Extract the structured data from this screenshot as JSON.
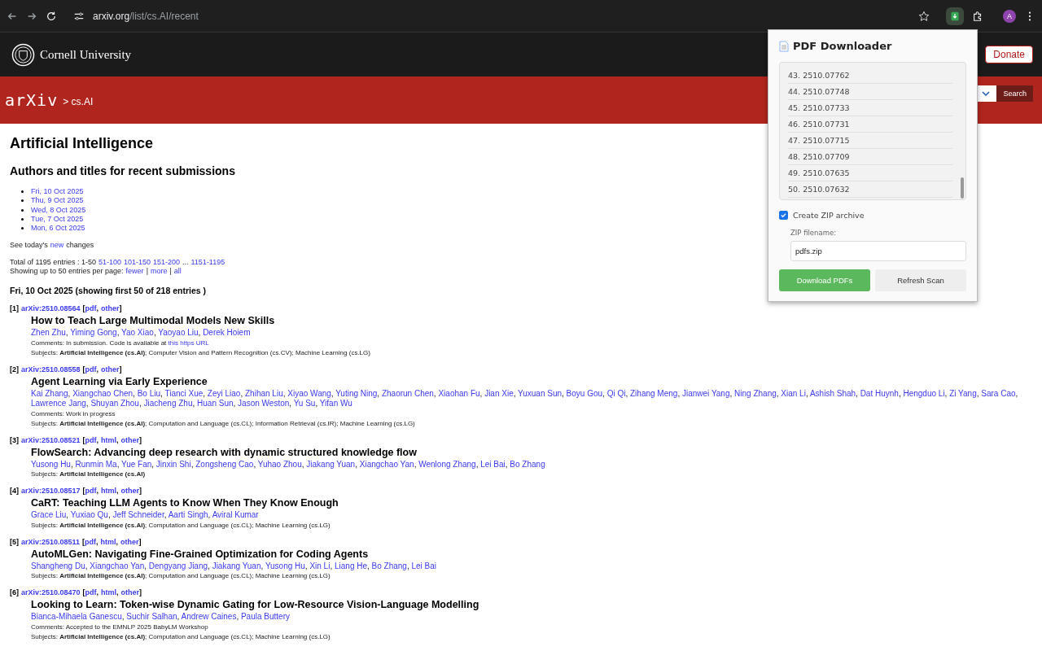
{
  "browser": {
    "url_host": "arxiv.org",
    "url_path": "/list/cs.AI/recent",
    "avatar": "A"
  },
  "header": {
    "institution": "Cornell University",
    "donate": "Donate",
    "logo": "arXiv",
    "breadcrumb": "> cs.AI",
    "search_button": "Search"
  },
  "popup": {
    "title": "PDF Downloader",
    "items": [
      "43. 2510.07762",
      "44. 2510.07748",
      "45. 2510.07733",
      "46. 2510.07731",
      "47. 2510.07715",
      "48. 2510.07709",
      "49. 2510.07635",
      "50. 2510.07632"
    ],
    "zip_archive": {
      "label": "Create ZIP archive",
      "checked": true
    },
    "filename_label": "ZIP filename:",
    "filename_value": "pdfs.zip",
    "buttons": [
      {
        "label": "Download PDFs",
        "kind": "primary"
      },
      {
        "label": "Refresh Scan",
        "kind": "secondary"
      }
    ]
  },
  "page": {
    "title": "Artificial Intelligence",
    "subtitle": "Authors and titles for recent submissions",
    "dates": [
      "Fri, 10 Oct 2025",
      "Thu, 9 Oct 2025",
      "Wed, 8 Oct 2025",
      "Tue, 7 Oct 2025",
      "Mon, 6 Oct 2025"
    ],
    "changes": {
      "prefix": "See today's",
      "link": "new",
      "suffix": "changes"
    },
    "total": {
      "text": "Total of 1195 entries : 1-50",
      "links": [
        "51-100",
        "101-150",
        "151-200"
      ],
      "ellipsis": "...",
      "last": "1151-1195"
    },
    "per_page": {
      "text": "Showing up to 50 entries per page:",
      "links": [
        {
          "label": "fewer",
          "sep": "|"
        },
        {
          "label": "more",
          "sep": "|"
        },
        {
          "label": "all"
        }
      ]
    },
    "day_heading": "Fri, 10 Oct 2025 (showing first 50 of 218 entries )",
    "entries": [
      {
        "index": "[1]",
        "id": "arXiv:2510.08564",
        "open": "[",
        "close": "]",
        "formats": [
          {
            "label": "pdf",
            "sep": ","
          },
          {
            "label": "other"
          }
        ],
        "title": "How to Teach Large Multimodal Models New Skills",
        "authors": [
          {
            "name": "Zhen Zhu",
            "sep": ","
          },
          {
            "name": "Yiming Gong",
            "sep": ","
          },
          {
            "name": "Yao Xiao",
            "sep": ","
          },
          {
            "name": "Yaoyao Liu",
            "sep": ","
          },
          {
            "name": "Derek Hoiem"
          }
        ],
        "comments": {
          "text": "Comments: In submission. Code is available at",
          "link": "this https URL"
        },
        "subjects": "Subjects: **Artificial Intelligence (cs.AI)**; Computer Vision and Pattern Recognition (cs.CV); Machine Learning (cs.LG)"
      },
      {
        "index": "[2]",
        "id": "arXiv:2510.08558",
        "open": "[",
        "close": "]",
        "formats": [
          {
            "label": "pdf",
            "sep": ","
          },
          {
            "label": "other"
          }
        ],
        "title": "Agent Learning via Early Experience",
        "authors": [
          {
            "name": "Kai Zhang",
            "sep": ","
          },
          {
            "name": "Xiangchao Chen",
            "sep": ","
          },
          {
            "name": "Bo Liu",
            "sep": ","
          },
          {
            "name": "Tianci Xue",
            "sep": ","
          },
          {
            "name": "Zeyi Liao",
            "sep": ","
          },
          {
            "name": "Zhihan Liu",
            "sep": ","
          },
          {
            "name": "Xiyao Wang",
            "sep": ","
          },
          {
            "name": "Yuting Ning",
            "sep": ","
          },
          {
            "name": "Zhaorun Chen",
            "sep": ","
          },
          {
            "name": "Xiaohan Fu",
            "sep": ","
          },
          {
            "name": "Jian Xie",
            "sep": ","
          },
          {
            "name": "Yuxuan Sun",
            "sep": ","
          },
          {
            "name": "Boyu Gou",
            "sep": ","
          },
          {
            "name": "Qi Qi",
            "sep": ","
          },
          {
            "name": "Zihang Meng",
            "sep": ","
          },
          {
            "name": "Jianwei Yang",
            "sep": ","
          },
          {
            "name": "Ning Zhang",
            "sep": ","
          },
          {
            "name": "Xian Li",
            "sep": ","
          },
          {
            "name": "Ashish Shah",
            "sep": ","
          },
          {
            "name": "Dat Huynh",
            "sep": ","
          },
          {
            "name": "Hengduo Li",
            "sep": ","
          },
          {
            "name": "Zi Yang",
            "sep": ","
          },
          {
            "name": "Sara Cao",
            "sep": ","
          },
          {
            "name": "Lawrence Jang",
            "sep": ","
          },
          {
            "name": "Shuyan Zhou",
            "sep": ","
          },
          {
            "name": "Jiacheng Zhu",
            "sep": ","
          },
          {
            "name": "Huan Sun",
            "sep": ","
          },
          {
            "name": "Jason Weston",
            "sep": ","
          },
          {
            "name": "Yu Su",
            "sep": ","
          },
          {
            "name": "Yifan Wu"
          }
        ],
        "comments": {
          "text": "Comments: Work in progress"
        },
        "subjects": "Subjects: **Artificial Intelligence (cs.AI)**; Computation and Language (cs.CL); Information Retrieval (cs.IR); Machine Learning (cs.LG)"
      },
      {
        "index": "[3]",
        "id": "arXiv:2510.08521",
        "open": "[",
        "close": "]",
        "formats": [
          {
            "label": "pdf",
            "sep": ","
          },
          {
            "label": "html",
            "sep": ","
          },
          {
            "label": "other"
          }
        ],
        "title": "FlowSearch: Advancing deep research with dynamic structured knowledge flow",
        "authors": [
          {
            "name": "Yusong Hu",
            "sep": ","
          },
          {
            "name": "Runmin Ma",
            "sep": ","
          },
          {
            "name": "Yue Fan",
            "sep": ","
          },
          {
            "name": "Jinxin Shi",
            "sep": ","
          },
          {
            "name": "Zongsheng Cao",
            "sep": ","
          },
          {
            "name": "Yuhao Zhou",
            "sep": ","
          },
          {
            "name": "Jiakang Yuan",
            "sep": ","
          },
          {
            "name": "Xiangchao Yan",
            "sep": ","
          },
          {
            "name": "Wenlong Zhang",
            "sep": ","
          },
          {
            "name": "Lei Bai",
            "sep": ","
          },
          {
            "name": "Bo Zhang"
          }
        ],
        "subjects": "Subjects: **Artificial Intelligence (cs.AI)**"
      },
      {
        "index": "[4]",
        "id": "arXiv:2510.08517",
        "open": "[",
        "close": "]",
        "formats": [
          {
            "label": "pdf",
            "sep": ","
          },
          {
            "label": "html",
            "sep": ","
          },
          {
            "label": "other"
          }
        ],
        "title": "CaRT: Teaching LLM Agents to Know When They Know Enough",
        "authors": [
          {
            "name": "Grace Liu",
            "sep": ","
          },
          {
            "name": "Yuxiao Qu",
            "sep": ","
          },
          {
            "name": "Jeff Schneider",
            "sep": ","
          },
          {
            "name": "Aarti Singh",
            "sep": ","
          },
          {
            "name": "Aviral Kumar"
          }
        ],
        "subjects": "Subjects: **Artificial Intelligence (cs.AI)**; Computation and Language (cs.CL); Machine Learning (cs.LG)"
      },
      {
        "index": "[5]",
        "id": "arXiv:2510.08511",
        "open": "[",
        "close": "]",
        "formats": [
          {
            "label": "pdf",
            "sep": ","
          },
          {
            "label": "html",
            "sep": ","
          },
          {
            "label": "other"
          }
        ],
        "title": "AutoMLGen: Navigating Fine-Grained Optimization for Coding Agents",
        "authors": [
          {
            "name": "Shangheng Du",
            "sep": ","
          },
          {
            "name": "Xiangchao Yan",
            "sep": ","
          },
          {
            "name": "Dengyang Jiang",
            "sep": ","
          },
          {
            "name": "Jiakang Yuan",
            "sep": ","
          },
          {
            "name": "Yusong Hu",
            "sep": ","
          },
          {
            "name": "Xin Li",
            "sep": ","
          },
          {
            "name": "Liang He",
            "sep": ","
          },
          {
            "name": "Bo Zhang",
            "sep": ","
          },
          {
            "name": "Lei Bai"
          }
        ],
        "subjects": "Subjects: **Artificial Intelligence (cs.AI)**; Computation and Language (cs.CL); Machine Learning (cs.LG)"
      },
      {
        "index": "[6]",
        "id": "arXiv:2510.08470",
        "open": "[",
        "close": "]",
        "formats": [
          {
            "label": "pdf",
            "sep": ","
          },
          {
            "label": "html",
            "sep": ","
          },
          {
            "label": "other"
          }
        ],
        "title": "Looking to Learn: Token-wise Dynamic Gating for Low-Resource Vision-Language Modelling",
        "authors": [
          {
            "name": "Bianca-Mihaela Ganescu",
            "sep": ","
          },
          {
            "name": "Suchir Salhan",
            "sep": ","
          },
          {
            "name": "Andrew Caines",
            "sep": ","
          },
          {
            "name": "Paula Buttery"
          }
        ],
        "comments": {
          "text": "Comments: Accepted to the EMNLP 2025 BabyLM Workshop"
        },
        "subjects": "Subjects: **Artificial Intelligence (cs.AI)**; Computation and Language (cs.CL); Machine Learning (cs.LG)"
      }
    ]
  }
}
